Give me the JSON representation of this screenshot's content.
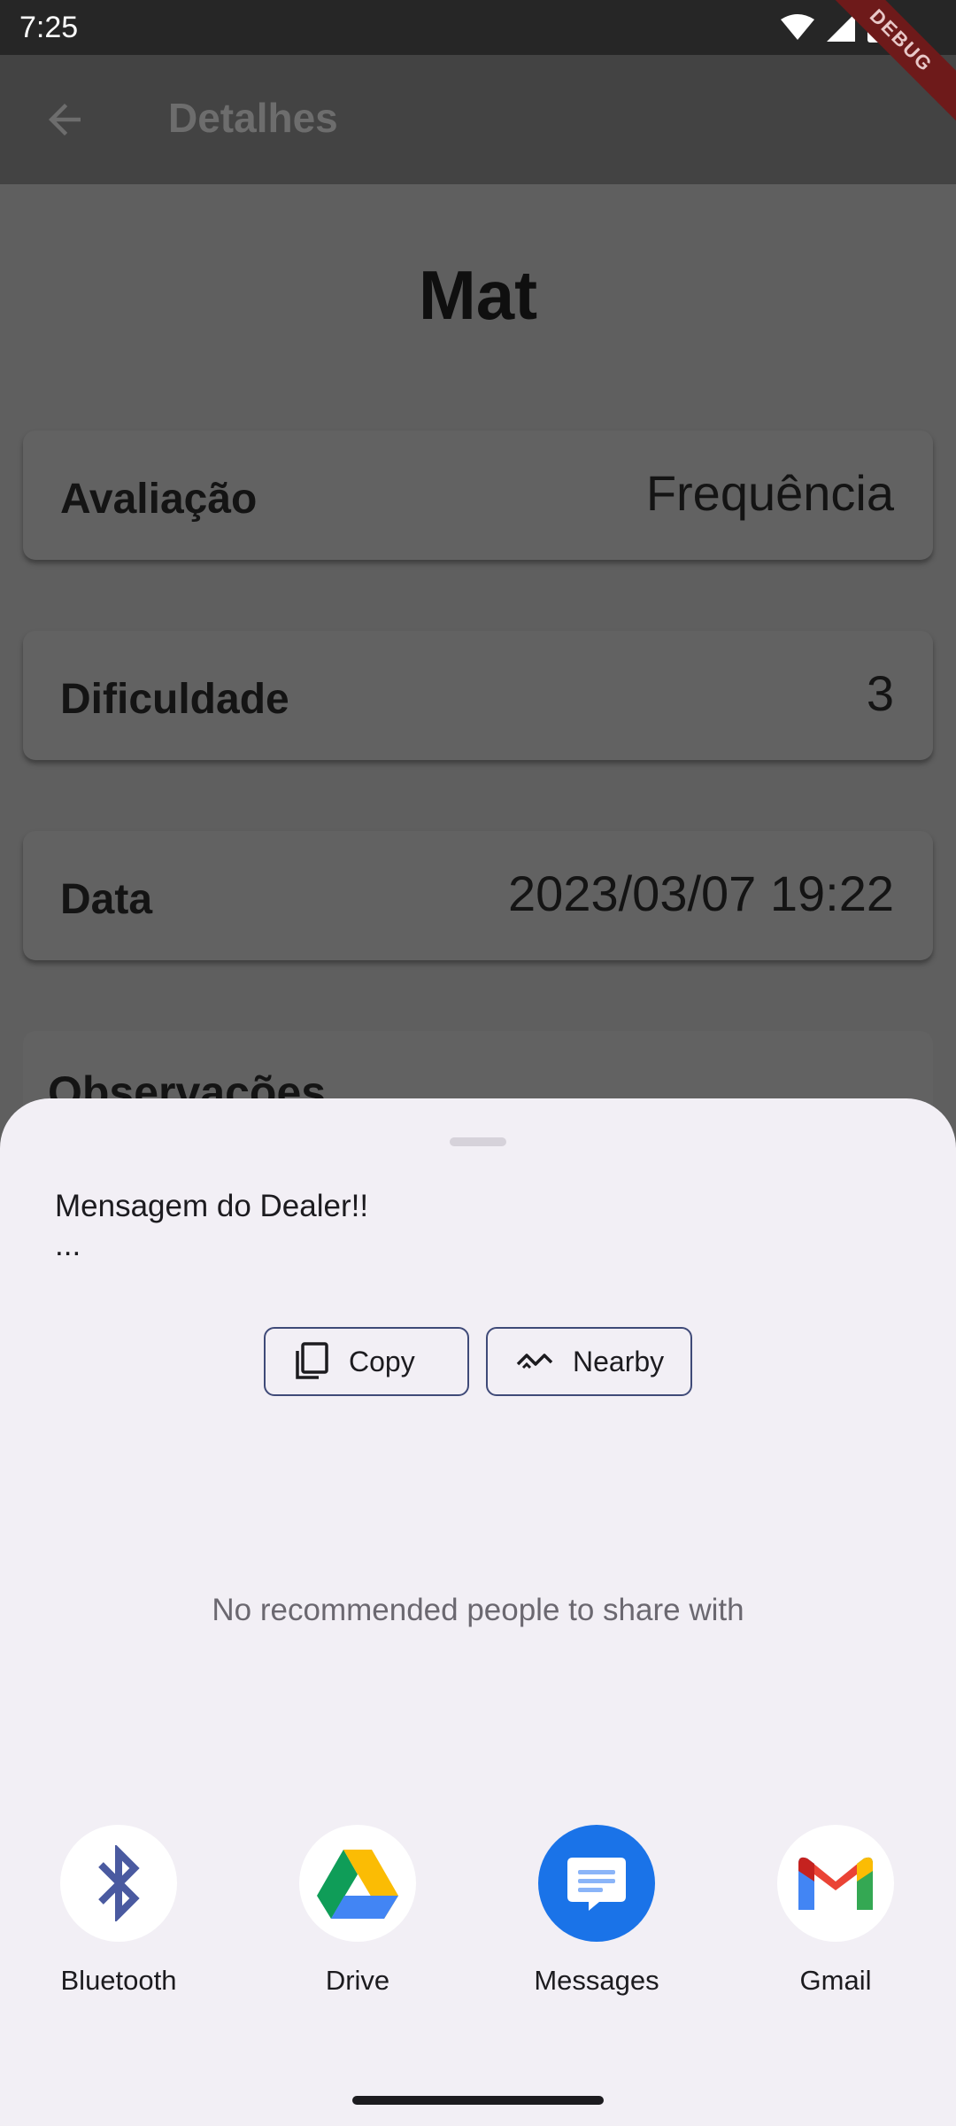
{
  "status_bar": {
    "time": "7:25",
    "debug_label": "DEBUG"
  },
  "app_bar": {
    "title": "Detalhes"
  },
  "details": {
    "subject": "Mat",
    "rows": [
      {
        "label": "Avaliação",
        "value": "Frequência"
      },
      {
        "label": "Dificuldade",
        "value": "3"
      },
      {
        "label": "Data",
        "value": "2023/03/07 19:22"
      }
    ],
    "observations_label": "Observações"
  },
  "share_sheet": {
    "message": "Mensagem do Dealer!!\n...",
    "copy_label": "Copy",
    "nearby_label": "Nearby",
    "no_recommendations": "No recommended people to share with",
    "apps": [
      {
        "label": "Bluetooth",
        "icon": "bluetooth-icon"
      },
      {
        "label": "Drive",
        "icon": "drive-icon"
      },
      {
        "label": "Messages",
        "icon": "messages-icon"
      },
      {
        "label": "Gmail",
        "icon": "gmail-icon"
      }
    ]
  },
  "colors": {
    "scrim": "#5f5f5f",
    "sheet_bg": "#f2eff5",
    "chip_border": "#3f4a78",
    "messages_blue": "#1a73e8",
    "bluetooth_blue": "#4a5aa0"
  }
}
